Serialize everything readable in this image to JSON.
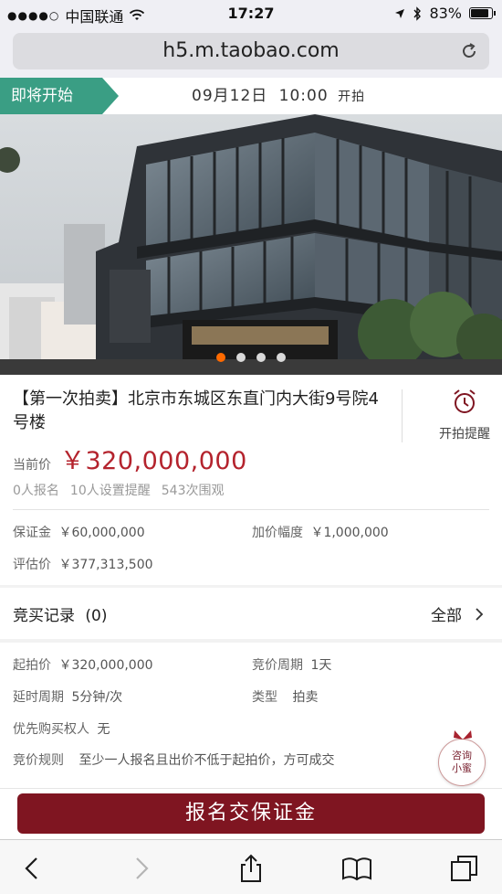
{
  "statusbar": {
    "carrier": "中国联通",
    "time": "17:27",
    "battery": "83%",
    "icons": [
      "signal-dots-icon",
      "wifi-icon",
      "location-arrow-icon",
      "bluetooth-icon",
      "battery-icon"
    ]
  },
  "browser": {
    "url": "h5.m.taobao.com",
    "reload_icon": "reload-icon"
  },
  "auction_header": {
    "status_tag": "即将开始",
    "start_date": "09月12日",
    "start_time": "10:00",
    "start_suffix": "开拍"
  },
  "hero": {
    "slides_count": 4,
    "active_slide": 1
  },
  "item": {
    "title": "【第一次拍卖】北京市东城区东直门内大街9号院4号楼",
    "remind_label": "开拍提醒",
    "remind_icon": "alarm-clock-icon",
    "price_label": "当前价",
    "price_value": "￥320,000,000",
    "stats": {
      "signups": "0人报名",
      "reminders": "10人设置提醒",
      "views": "543次围观"
    },
    "deposit_label": "保证金",
    "deposit_value": "￥60,000,000",
    "increment_label": "加价幅度",
    "increment_value": "￥1,000,000",
    "appraisal_label": "评估价",
    "appraisal_value": "￥377,313,500"
  },
  "bids": {
    "title": "竞买记录",
    "count": "(0)",
    "all_label": "全部"
  },
  "rules": {
    "start_price_label": "起拍价",
    "start_price_value": "￥320,000,000",
    "bid_period_label": "竞价周期",
    "bid_period_value": "1天",
    "extension_label": "延时周期",
    "extension_value": "5分钟/次",
    "type_label": "类型",
    "type_value": "拍卖",
    "priority_label": "优先购买权人",
    "priority_value": "无",
    "rule_label": "竞价规则",
    "rule_value": "至少一人报名且出价不低于起拍价，方可成交"
  },
  "consult": {
    "line1": "咨询",
    "line2": "小蜜"
  },
  "cta": {
    "label": "报名交保证金"
  },
  "colors": {
    "accent_green": "#3a9e84",
    "price_red": "#b4232d",
    "cta_maroon": "#7f1521",
    "carousel_active": "#ff6a00"
  }
}
